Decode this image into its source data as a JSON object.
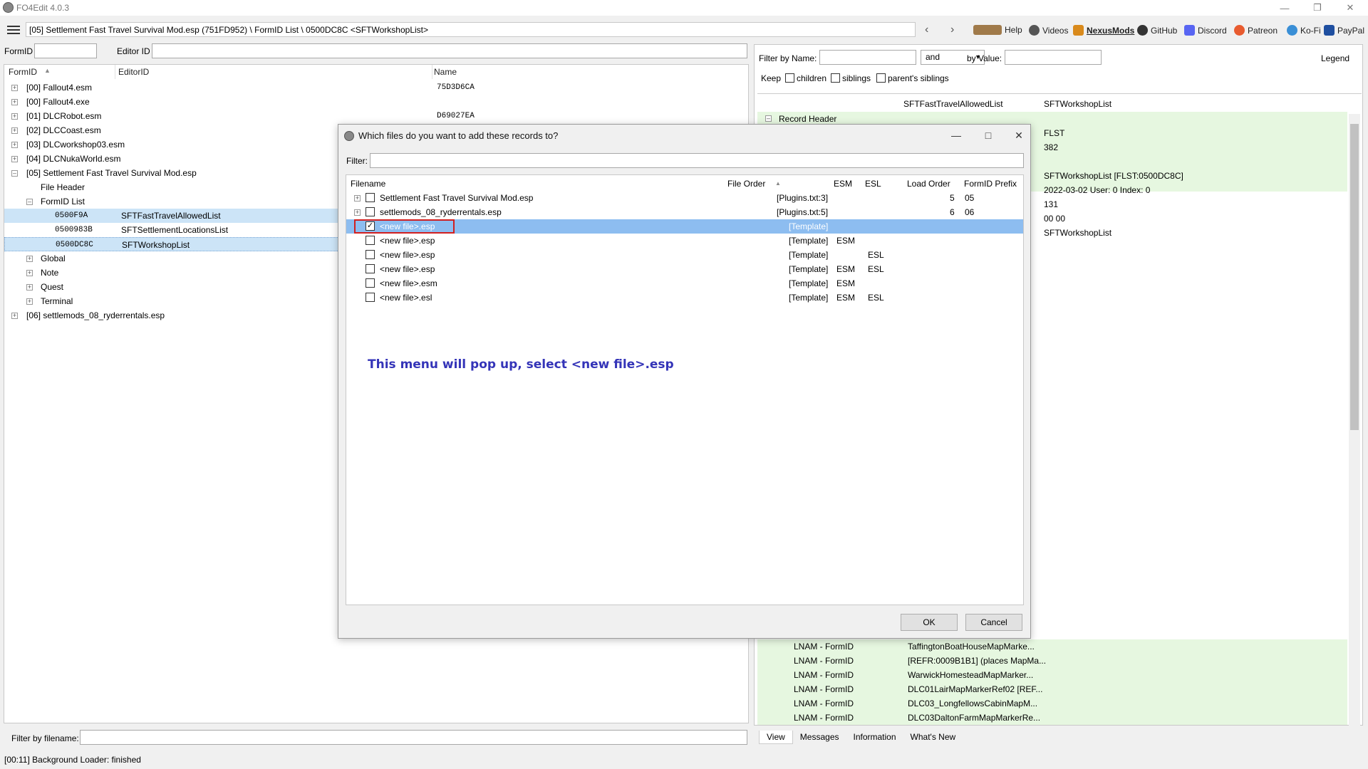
{
  "app": {
    "title": "FO4Edit 4.0.3"
  },
  "toolbar": {
    "path": "[05] Settlement Fast Travel Survival Mod.esp (751FD952) \\ FormID List \\ 0500DC8C <SFTWorkshopList>",
    "links": [
      "Help",
      "Videos",
      "NexusMods",
      "GitHub",
      "Discord",
      "Patreon",
      "Ko-Fi",
      "PayPal"
    ]
  },
  "left": {
    "formid_label": "FormID",
    "editorid_label": "Editor ID",
    "columns": [
      "FormID",
      "EditorID",
      "Name"
    ],
    "tree": [
      {
        "label": "[00] Fallout4.esm",
        "name": "75D3D6CA"
      },
      {
        "label": "[00] Fallout4.exe",
        "name": ""
      },
      {
        "label": "[01] DLCRobot.esm",
        "name": "D69027EA"
      },
      {
        "label": "[02] DLCCoast.esm",
        "name": ""
      },
      {
        "label": "[03] DLCworkshop03.esm",
        "name": ""
      },
      {
        "label": "[04] DLCNukaWorld.esm",
        "name": ""
      },
      {
        "label": "[05] Settlement Fast Travel Survival Mod.esp",
        "name": ""
      },
      {
        "label": "File Header",
        "name": ""
      },
      {
        "label": "FormID List",
        "name": ""
      },
      {
        "label": "0500F9A",
        "editor": "SFTFastTravelAllowedList"
      },
      {
        "label": "0500983B",
        "editor": "SFTSettlementLocationsList"
      },
      {
        "label": "0500DC8C",
        "editor": "SFTWorkshopList"
      },
      {
        "label": "Global",
        "name": ""
      },
      {
        "label": "Note",
        "name": ""
      },
      {
        "label": "Quest",
        "name": ""
      },
      {
        "label": "Terminal",
        "name": ""
      },
      {
        "label": "[06] settlemods_08_ryderrentals.esp",
        "name": ""
      }
    ],
    "filter_by_filename_label": "Filter by filename:"
  },
  "right": {
    "filter_by_name_label": "Filter by Name:",
    "and_value": "and",
    "by_value_label": "by Value:",
    "legend_label": "Legend",
    "keep_label": "Keep",
    "children_label": "children",
    "siblings_label": "siblings",
    "parents_siblings_label": "parent's siblings",
    "col1": "SFTFastTravelAllowedList",
    "col2": "SFTWorkshopList",
    "record_header": "Record Header",
    "values": [
      "FLST",
      "382",
      "SFTWorkshopList [FLST:0500DC8C]",
      "2022-03-02 User: 0 Index: 0",
      "131",
      "00 00",
      "SFTWorkshopList"
    ],
    "lnam_rows": [
      {
        "label": "LNAM - FormID",
        "value": "TaffingtonBoatHouseMapMarke..."
      },
      {
        "label": "LNAM - FormID",
        "value": "[REFR:0009B1B1] (places MapMa..."
      },
      {
        "label": "LNAM - FormID",
        "value": "WarwickHomesteadMapMarker..."
      },
      {
        "label": "LNAM - FormID",
        "value": "DLC01LairMapMarkerRef02 [REF..."
      },
      {
        "label": "LNAM - FormID",
        "value": "DLC03_LongfellowsCabinMapM..."
      },
      {
        "label": "LNAM - FormID",
        "value": "DLC03DaltonFarmMapMarkerRe..."
      }
    ],
    "tabs": [
      "View",
      "Messages",
      "Information",
      "What's New"
    ]
  },
  "dialog": {
    "title": "Which files do you want to add these records to?",
    "filter_label": "Filter:",
    "columns": [
      "Filename",
      "File Order",
      "ESM",
      "ESL",
      "Load Order",
      "FormID Prefix"
    ],
    "rows": [
      {
        "filename": "Settlement Fast Travel Survival Mod.esp",
        "order": "[Plugins.txt:3]",
        "esm": "",
        "esl": "",
        "load": "5",
        "prefix": "05",
        "checked": false,
        "expand": true
      },
      {
        "filename": "settlemods_08_ryderrentals.esp",
        "order": "[Plugins.txt:5]",
        "esm": "",
        "esl": "",
        "load": "6",
        "prefix": "06",
        "checked": false,
        "expand": true
      },
      {
        "filename": "<new file>.esp",
        "order": "[Template]",
        "esm": "",
        "esl": "",
        "load": "",
        "prefix": "",
        "checked": true,
        "selected": true
      },
      {
        "filename": "<new file>.esp",
        "order": "[Template]",
        "esm": "ESM",
        "esl": "",
        "load": "",
        "prefix": "",
        "checked": false
      },
      {
        "filename": "<new file>.esp",
        "order": "[Template]",
        "esm": "",
        "esl": "ESL",
        "load": "",
        "prefix": "",
        "checked": false
      },
      {
        "filename": "<new file>.esp",
        "order": "[Template]",
        "esm": "ESM",
        "esl": "ESL",
        "load": "",
        "prefix": "",
        "checked": false
      },
      {
        "filename": "<new file>.esm",
        "order": "[Template]",
        "esm": "ESM",
        "esl": "",
        "load": "",
        "prefix": "",
        "checked": false
      },
      {
        "filename": "<new file>.esl",
        "order": "[Template]",
        "esm": "ESM",
        "esl": "ESL",
        "load": "",
        "prefix": "",
        "checked": false
      }
    ],
    "annotation": "This menu will pop up, select <new file>.esp",
    "ok_label": "OK",
    "cancel_label": "Cancel"
  },
  "status": {
    "text": "[00:11] Background Loader: finished"
  }
}
